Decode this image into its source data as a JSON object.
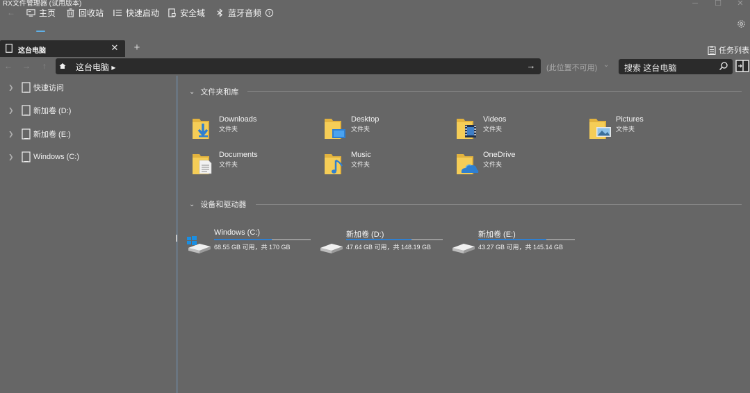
{
  "window": {
    "title": "RX文件管理器 (试用版本)"
  },
  "commandbar": {
    "home": "主页",
    "recycle": "回收站",
    "quicklaunch": "快速启动",
    "security": "安全域",
    "bluetooth": "蓝牙音频"
  },
  "tabs": [
    {
      "label": "这台电脑",
      "active": true
    }
  ],
  "tasklist_label": "任务列表",
  "address": {
    "path": "这台电脑 ▸",
    "location_unavailable": "(此位置不可用)",
    "search_placeholder": "搜索 这台电脑"
  },
  "sidebar": {
    "items": [
      {
        "label": "快速访问"
      },
      {
        "label": "新加卷 (D:)"
      },
      {
        "label": "新加卷 (E:)"
      },
      {
        "label": "Windows (C:)"
      }
    ]
  },
  "sections": {
    "folders_title": "文件夹和库",
    "drives_title": "设备和驱动器"
  },
  "folders": [
    {
      "name": "Downloads",
      "type": "文件夹",
      "icon": "downloads-folder-icon"
    },
    {
      "name": "Desktop",
      "type": "文件夹",
      "icon": "desktop-folder-icon"
    },
    {
      "name": "Videos",
      "type": "文件夹",
      "icon": "videos-folder-icon"
    },
    {
      "name": "Pictures",
      "type": "文件夹",
      "icon": "pictures-folder-icon"
    },
    {
      "name": "Documents",
      "type": "文件夹",
      "icon": "documents-folder-icon"
    },
    {
      "name": "Music",
      "type": "文件夹",
      "icon": "music-folder-icon"
    },
    {
      "name": "OneDrive",
      "type": "文件夹",
      "icon": "onedrive-folder-icon"
    }
  ],
  "drives": [
    {
      "name": "Windows (C:)",
      "free": "68.55 GB 可用，共 170 GB",
      "used_fraction": 0.597
    },
    {
      "name": "新加卷 (D:)",
      "free": "47.64 GB 可用，共 148.19 GB",
      "used_fraction": 0.678
    },
    {
      "name": "新加卷 (E:)",
      "free": "43.27 GB 可用，共 145.14 GB",
      "used_fraction": 0.702
    }
  ],
  "colors": {
    "background": "#666666",
    "panel_dark": "#2b2b2b",
    "accent": "#2f7fd0",
    "folder": "#f5c84a"
  }
}
